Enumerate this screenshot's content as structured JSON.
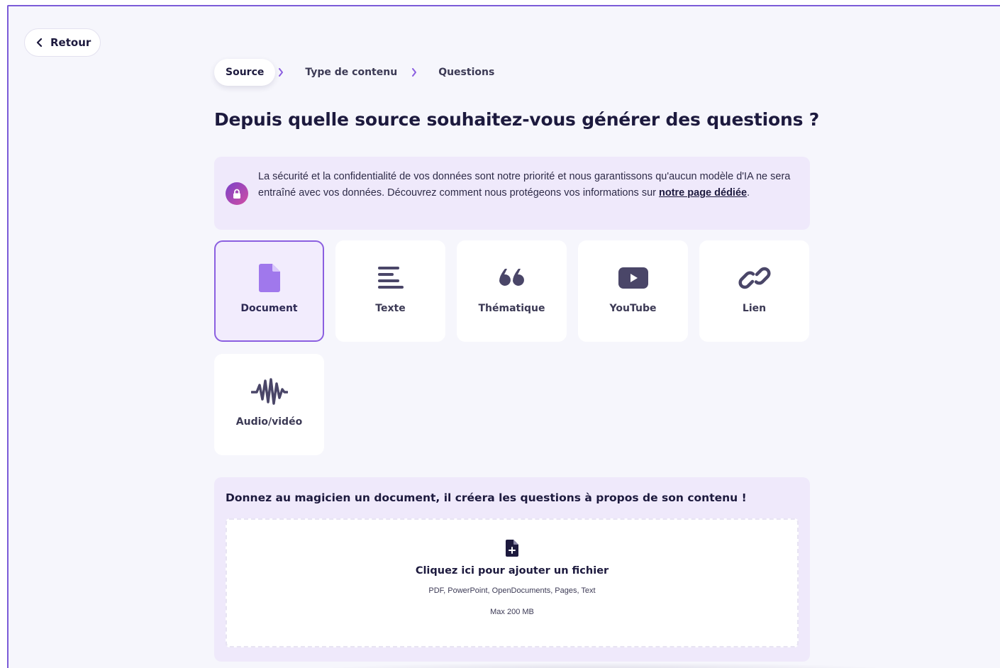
{
  "nav": {
    "back_label": "Retour"
  },
  "steps": [
    {
      "label": "Source",
      "active": true
    },
    {
      "label": "Type de contenu",
      "active": false
    },
    {
      "label": "Questions",
      "active": false
    }
  ],
  "page": {
    "title": "Depuis quelle source souhaitez-vous générer des questions ?"
  },
  "notice": {
    "text": "La sécurité et la confidentialité de vos données sont notre priorité et nous garantissons qu'aucun modèle d'IA ne sera entraîné avec vos données. Découvrez comment nous protégeons vos informations sur ",
    "link": "notre page dédiée",
    "suffix": "."
  },
  "sources": [
    {
      "label": "Document",
      "icon": "document-icon",
      "selected": true
    },
    {
      "label": "Texte",
      "icon": "text-lines-icon",
      "selected": false
    },
    {
      "label": "Thématique",
      "icon": "quote-icon",
      "selected": false
    },
    {
      "label": "YouTube",
      "icon": "youtube-icon",
      "selected": false
    },
    {
      "label": "Lien",
      "icon": "link-icon",
      "selected": false
    },
    {
      "label": "Audio/vidéo",
      "icon": "waveform-icon",
      "selected": false
    }
  ],
  "upload": {
    "heading": "Donnez au magicien un document, il créera les questions à propos de son contenu !",
    "cta": "Cliquez ici pour ajouter un fichier",
    "formats": "PDF, PowerPoint, OpenDocuments, Pages, Text",
    "max_size": "Max 200 MB"
  },
  "colors": {
    "accent": "#8b5fe0",
    "text": "#1d1a3e",
    "panel_bg": "#efe9fb"
  }
}
